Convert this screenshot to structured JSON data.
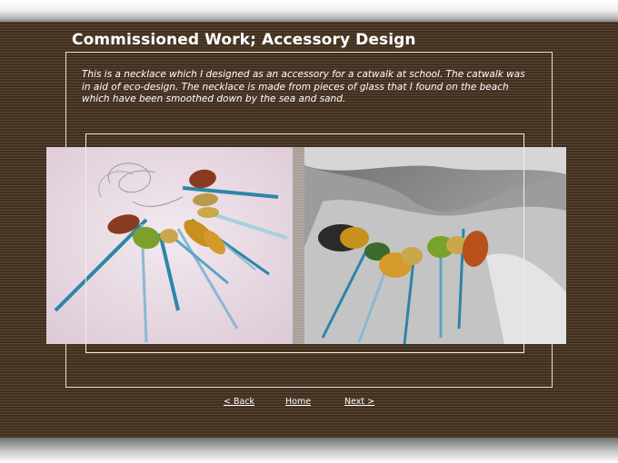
{
  "page": {
    "title": "Commissioned Work; Accessory Design",
    "description": "This is a necklace which I designed as an accessory for a catwalk at school. The catwalk was in aid of eco-design. The necklace is made from pieces of glass that I found on the beach which have been smoothed down by the sea and sand."
  },
  "nav": {
    "back_label": "< Back",
    "home_label": "Home",
    "next_label": "Next >"
  },
  "colors": {
    "panel_stripe_dark": "#3f2f20",
    "panel_stripe_light": "#5a4530",
    "text": "#ffffff",
    "ribbon_blue": "#2d86a8",
    "glass_amber": "#c8901c",
    "glass_green": "#7aa22a",
    "glass_brown": "#8a3a20"
  }
}
